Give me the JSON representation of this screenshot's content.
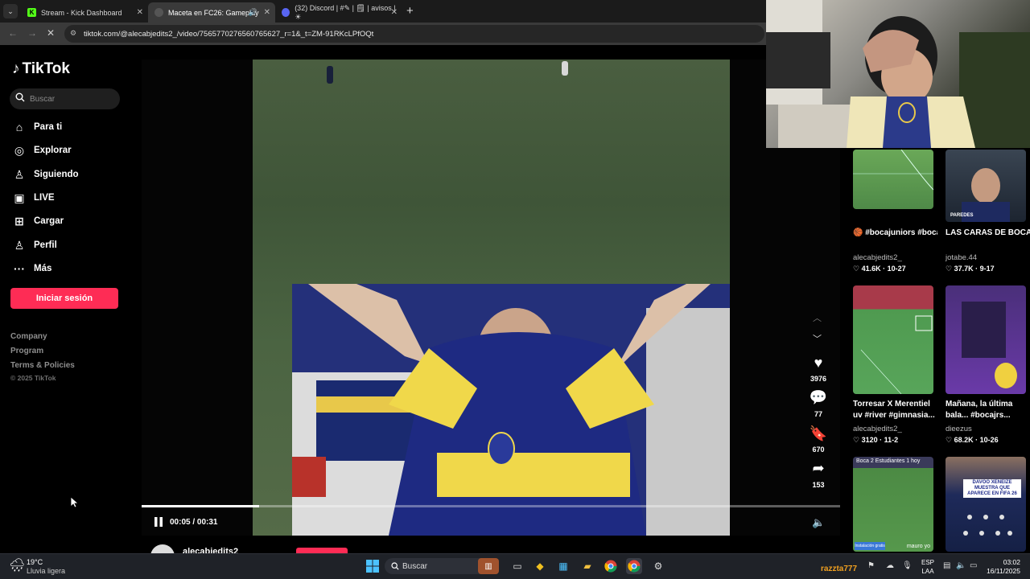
{
  "browser": {
    "tabs": [
      {
        "label": "Stream - Kick Dashboard",
        "favicon": "kick-icon",
        "color": "#53fc18",
        "active": false
      },
      {
        "label": "Maceta en FC26: Gameplay",
        "favicon": "tiktok-icon",
        "color": "#bbbbbb",
        "active": true
      },
      {
        "label": "(32) Discord | #✎ | 🗒 | avisos | ☀",
        "favicon": "discord-icon",
        "color": "#5865f2",
        "active": false
      }
    ],
    "url": "tiktok.com/@alecabjedits2_/video/7565770276560765627_r=1&_t=ZM-91RKcLPfOQt"
  },
  "tiktok": {
    "logo": "TikTok",
    "search_placeholder": "Buscar",
    "nav": [
      {
        "label": "Para ti",
        "icon": "home-icon"
      },
      {
        "label": "Explorar",
        "icon": "compass-icon"
      },
      {
        "label": "Siguiendo",
        "icon": "following-icon"
      },
      {
        "label": "LIVE",
        "icon": "live-icon"
      },
      {
        "label": "Cargar",
        "icon": "upload-icon"
      },
      {
        "label": "Perfil",
        "icon": "profile-icon"
      },
      {
        "label": "Más",
        "icon": "more-icon"
      }
    ],
    "login_label": "Iniciar sesión",
    "footer_links": [
      "Company",
      "Program",
      "Terms & Policies"
    ],
    "copyright": "© 2025 TikTok",
    "brand_color": "#fe2c55"
  },
  "player": {
    "time": "00:05 / 00:31",
    "progress": 0.168,
    "likes": "3976",
    "comments": "77",
    "saves": "670",
    "shares": "153",
    "author": "alecabjedits2_"
  },
  "related": [
    {
      "title": "🏀 #bocajuniors #boca #cabj...",
      "user": "alecabjedits2_",
      "stat": "♡ 41.6K · 10-27"
    },
    {
      "title": "LAS CARAS DE BOCA JUNIORS EN...",
      "user": "jotabe.44",
      "stat": "♡ 37.7K · 9-17"
    },
    {
      "title": "Torresar X Merentiel uv #river #gimnasia...",
      "user": "alecabjedits2_",
      "stat": "♡ 3120 · 11-2"
    },
    {
      "title": "Mañana, la última bala... #bocajrs...",
      "user": "dieezus",
      "stat": "♡ 68.2K · 10-26"
    },
    {
      "title": "",
      "user": "",
      "stat": "",
      "overlay": "Boca 2 Estudiantes 1 hoy",
      "tag": "mauro yo"
    },
    {
      "title": "",
      "user": "",
      "stat": "",
      "overlay": "DAVOO XENEIZE MUESTRA QUE APARECE EN FIFA 26",
      "tag": ""
    }
  ],
  "thumb_labels": {
    "paredes": "PAREDES",
    "instalacion": "Instalación gratis"
  },
  "taskbar": {
    "weather_temp": "19°C",
    "weather_desc": "Lluvia ligera",
    "search": "Buscar",
    "user": "razzta777",
    "lang1": "ESP",
    "lang2": "LAA",
    "time": "03:02",
    "date": "16/11/2025"
  }
}
